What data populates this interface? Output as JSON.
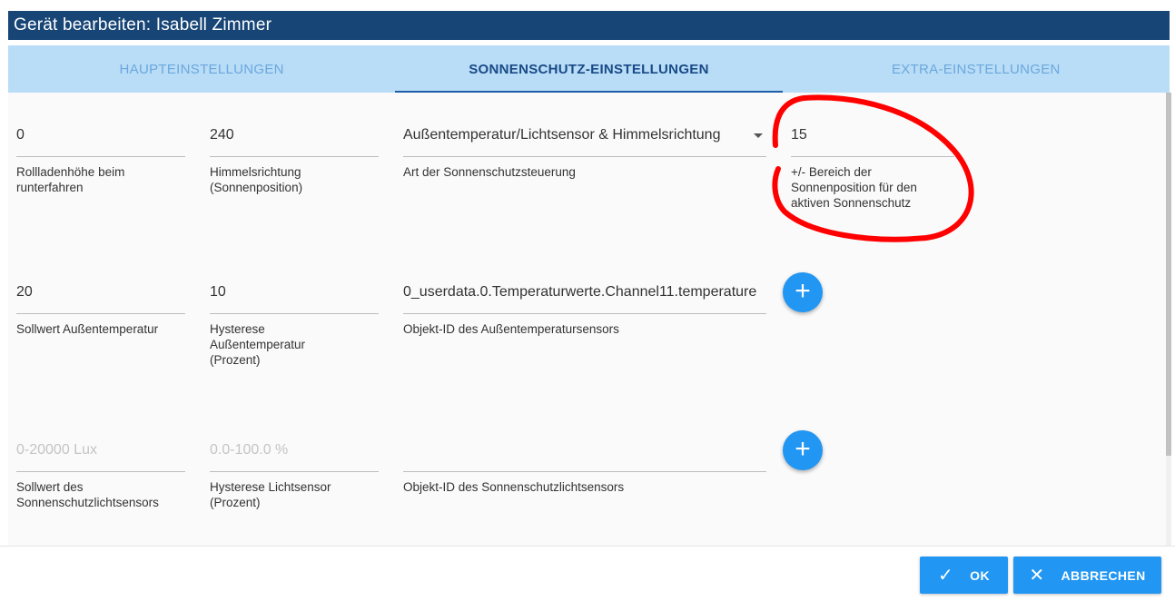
{
  "dialog": {
    "title": "Gerät bearbeiten: Isabell Zimmer"
  },
  "tabs": [
    {
      "label": "HAUPTEINSTELLUNGEN",
      "active": false
    },
    {
      "label": "SONNENSCHUTZ-EINSTELLUNGEN",
      "active": true
    },
    {
      "label": "EXTRA-EINSTELLUNGEN",
      "active": false
    }
  ],
  "row1": {
    "height": {
      "value": "0",
      "label": "Rollladenhöhe beim runterfahren"
    },
    "direction": {
      "value": "240",
      "label": "Himmelsrichtung (Sonnenposition)"
    },
    "type": {
      "value": "Außentemperatur/Lichtsensor & Himmelsrichtung",
      "label": "Art der Sonnenschutzsteuerung"
    },
    "range": {
      "value": "15",
      "label": "+/- Bereich der Sonnenposition für den aktiven Sonnenschutz"
    }
  },
  "row2": {
    "temp_setpoint": {
      "value": "20",
      "label": "Sollwert Außentemperatur"
    },
    "temp_hysteresis": {
      "value": "10",
      "label": "Hysterese Außentemperatur (Prozent)"
    },
    "temp_sensor": {
      "value": "0_userdata.0.Temperaturwerte.Channel11.temperature",
      "label": "Objekt-ID des Außentemperatursensors"
    }
  },
  "row3": {
    "light_setpoint": {
      "placeholder": "0-20000 Lux",
      "label": "Sollwert des Sonnenschutzlichtsensors"
    },
    "light_hysteresis": {
      "placeholder": "0.0-100.0 %",
      "label": "Hysterese Lichtsensor (Prozent)"
    },
    "light_sensor": {
      "value": "",
      "label": "Objekt-ID des Sonnenschutzlichtsensors"
    }
  },
  "icons": {
    "add": "plus-icon",
    "ok": "check-icon",
    "cancel": "close-icon"
  },
  "buttons": {
    "ok": "OK",
    "cancel": "ABBRECHEN"
  },
  "colors": {
    "header": "#174576",
    "tabs_bg": "#b9dcf7",
    "accent": "#2196f3",
    "annotation": "#ff0000"
  }
}
